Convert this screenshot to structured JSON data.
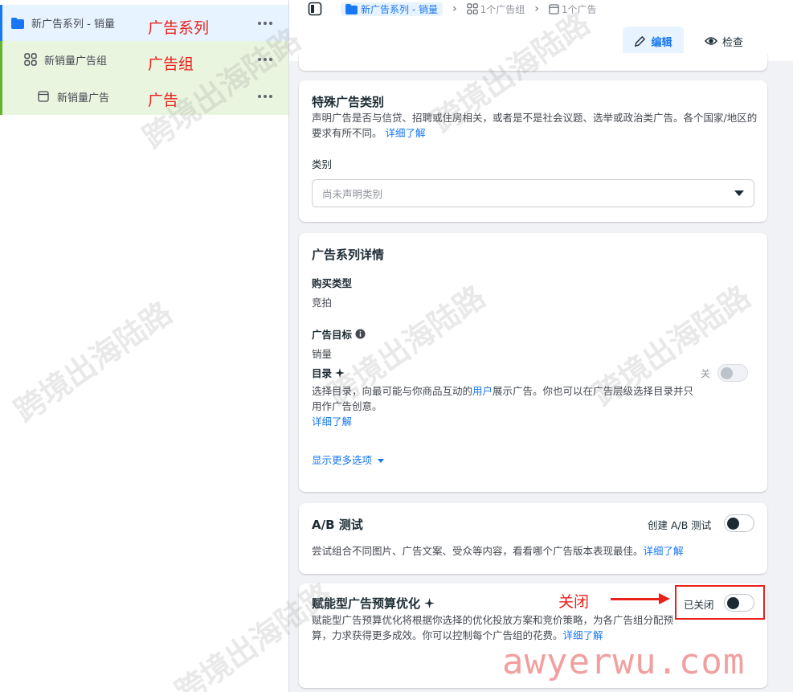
{
  "tree": {
    "campaign": {
      "label": "新广告系列 - 销量",
      "icon": "folder-icon",
      "annotation": "广告系列"
    },
    "adset": {
      "label": "新销量广告组",
      "icon": "grid-icon",
      "annotation": "广告组"
    },
    "ad": {
      "label": "新销量广告",
      "icon": "ad-page-icon",
      "annotation": "广告"
    }
  },
  "breadcrumb": {
    "campaign": "新广告系列 - 销量",
    "adsets": "1个广告组",
    "ads": "1个广告"
  },
  "toolbar": {
    "edit_label": "编辑",
    "view_label": "检查"
  },
  "special_category": {
    "title": "特殊广告类别",
    "description": "声明广告是否与信贷、招聘或住房相关，或者是不是社会议题、选举或政治类广告。各个国家/地区的要求有所不同。",
    "learn_more": "详细了解",
    "category_label": "类别",
    "select_placeholder": "尚未声明类别"
  },
  "campaign_details": {
    "title": "广告系列详情",
    "buying_type_label": "购买类型",
    "buying_type_value": "竞拍",
    "objective_label": "广告目标",
    "objective_value": "销量",
    "catalog_label": "目录",
    "catalog_toggle_label": "关",
    "catalog_desc_1": "选择目录，向最可能与你商品互动的",
    "catalog_desc_link": "用户",
    "catalog_desc_2": "展示广告。你也可以在广告层级选择目录并只用作广告创意。",
    "learn_more": "详细了解",
    "more_options": "显示更多选项"
  },
  "ab_test": {
    "title": "A/B 测试",
    "toggle_label": "创建 A/B 测试",
    "description": "尝试组合不同图片、广告文案、受众等内容，看看哪个广告版本表现最佳。",
    "learn_more": "详细了解"
  },
  "cbo": {
    "title": "赋能型广告预算优化",
    "toggle_label": "已关闭",
    "description": "赋能型广告预算优化将根据你选择的优化投放方案和竞价策略，为各广告组分配预算，力求获得更多成效。你可以控制每个广告组的花费。",
    "learn_more": "详细了解"
  },
  "annotations": {
    "close": "关闭"
  },
  "watermarks": {
    "text": "跨境出海陆路",
    "logo": "awyerwu.com"
  },
  "colors": {
    "accent": "#1877f2",
    "annotation_red": "#e8221b",
    "tree_green": "#eaf5e0"
  }
}
